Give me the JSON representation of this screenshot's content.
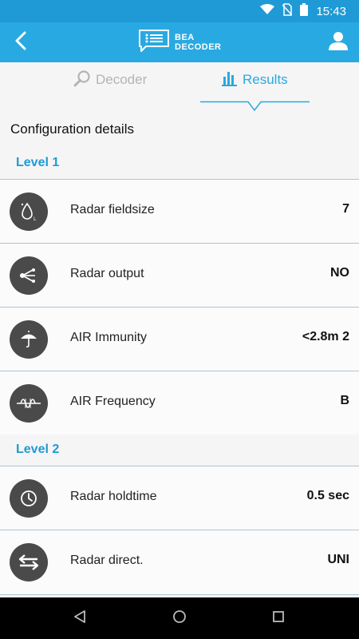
{
  "status_bar": {
    "time": "15:43"
  },
  "app_bar": {
    "brand_line1": "BEA",
    "brand_line2": "DECODER"
  },
  "tabs": [
    {
      "label": "Decoder",
      "icon": "magnifier-icon",
      "active": false
    },
    {
      "label": "Results",
      "icon": "bar-chart-icon",
      "active": true
    }
  ],
  "section_title": "Configuration details",
  "levels": [
    {
      "title": "Level 1",
      "rows": [
        {
          "label": "Radar fieldsize",
          "value": "7",
          "icon": "fieldsize-icon"
        },
        {
          "label": "Radar output",
          "value": "NO",
          "icon": "output-icon"
        },
        {
          "label": "AIR Immunity",
          "value": "<2.8m 2",
          "icon": "umbrella-icon"
        },
        {
          "label": "AIR Frequency",
          "value": "B",
          "icon": "frequency-icon"
        }
      ]
    },
    {
      "title": "Level 2",
      "rows": [
        {
          "label": "Radar holdtime",
          "value": "0.5 sec",
          "icon": "clock-icon"
        },
        {
          "label": "Radar direct.",
          "value": "UNI",
          "icon": "direction-arrows-icon"
        }
      ]
    }
  ],
  "colors": {
    "primary": "#29a9e1",
    "status_bar": "#1f9ad6",
    "divider": "#aec4d6",
    "icon_bg": "#4a4a4a"
  }
}
